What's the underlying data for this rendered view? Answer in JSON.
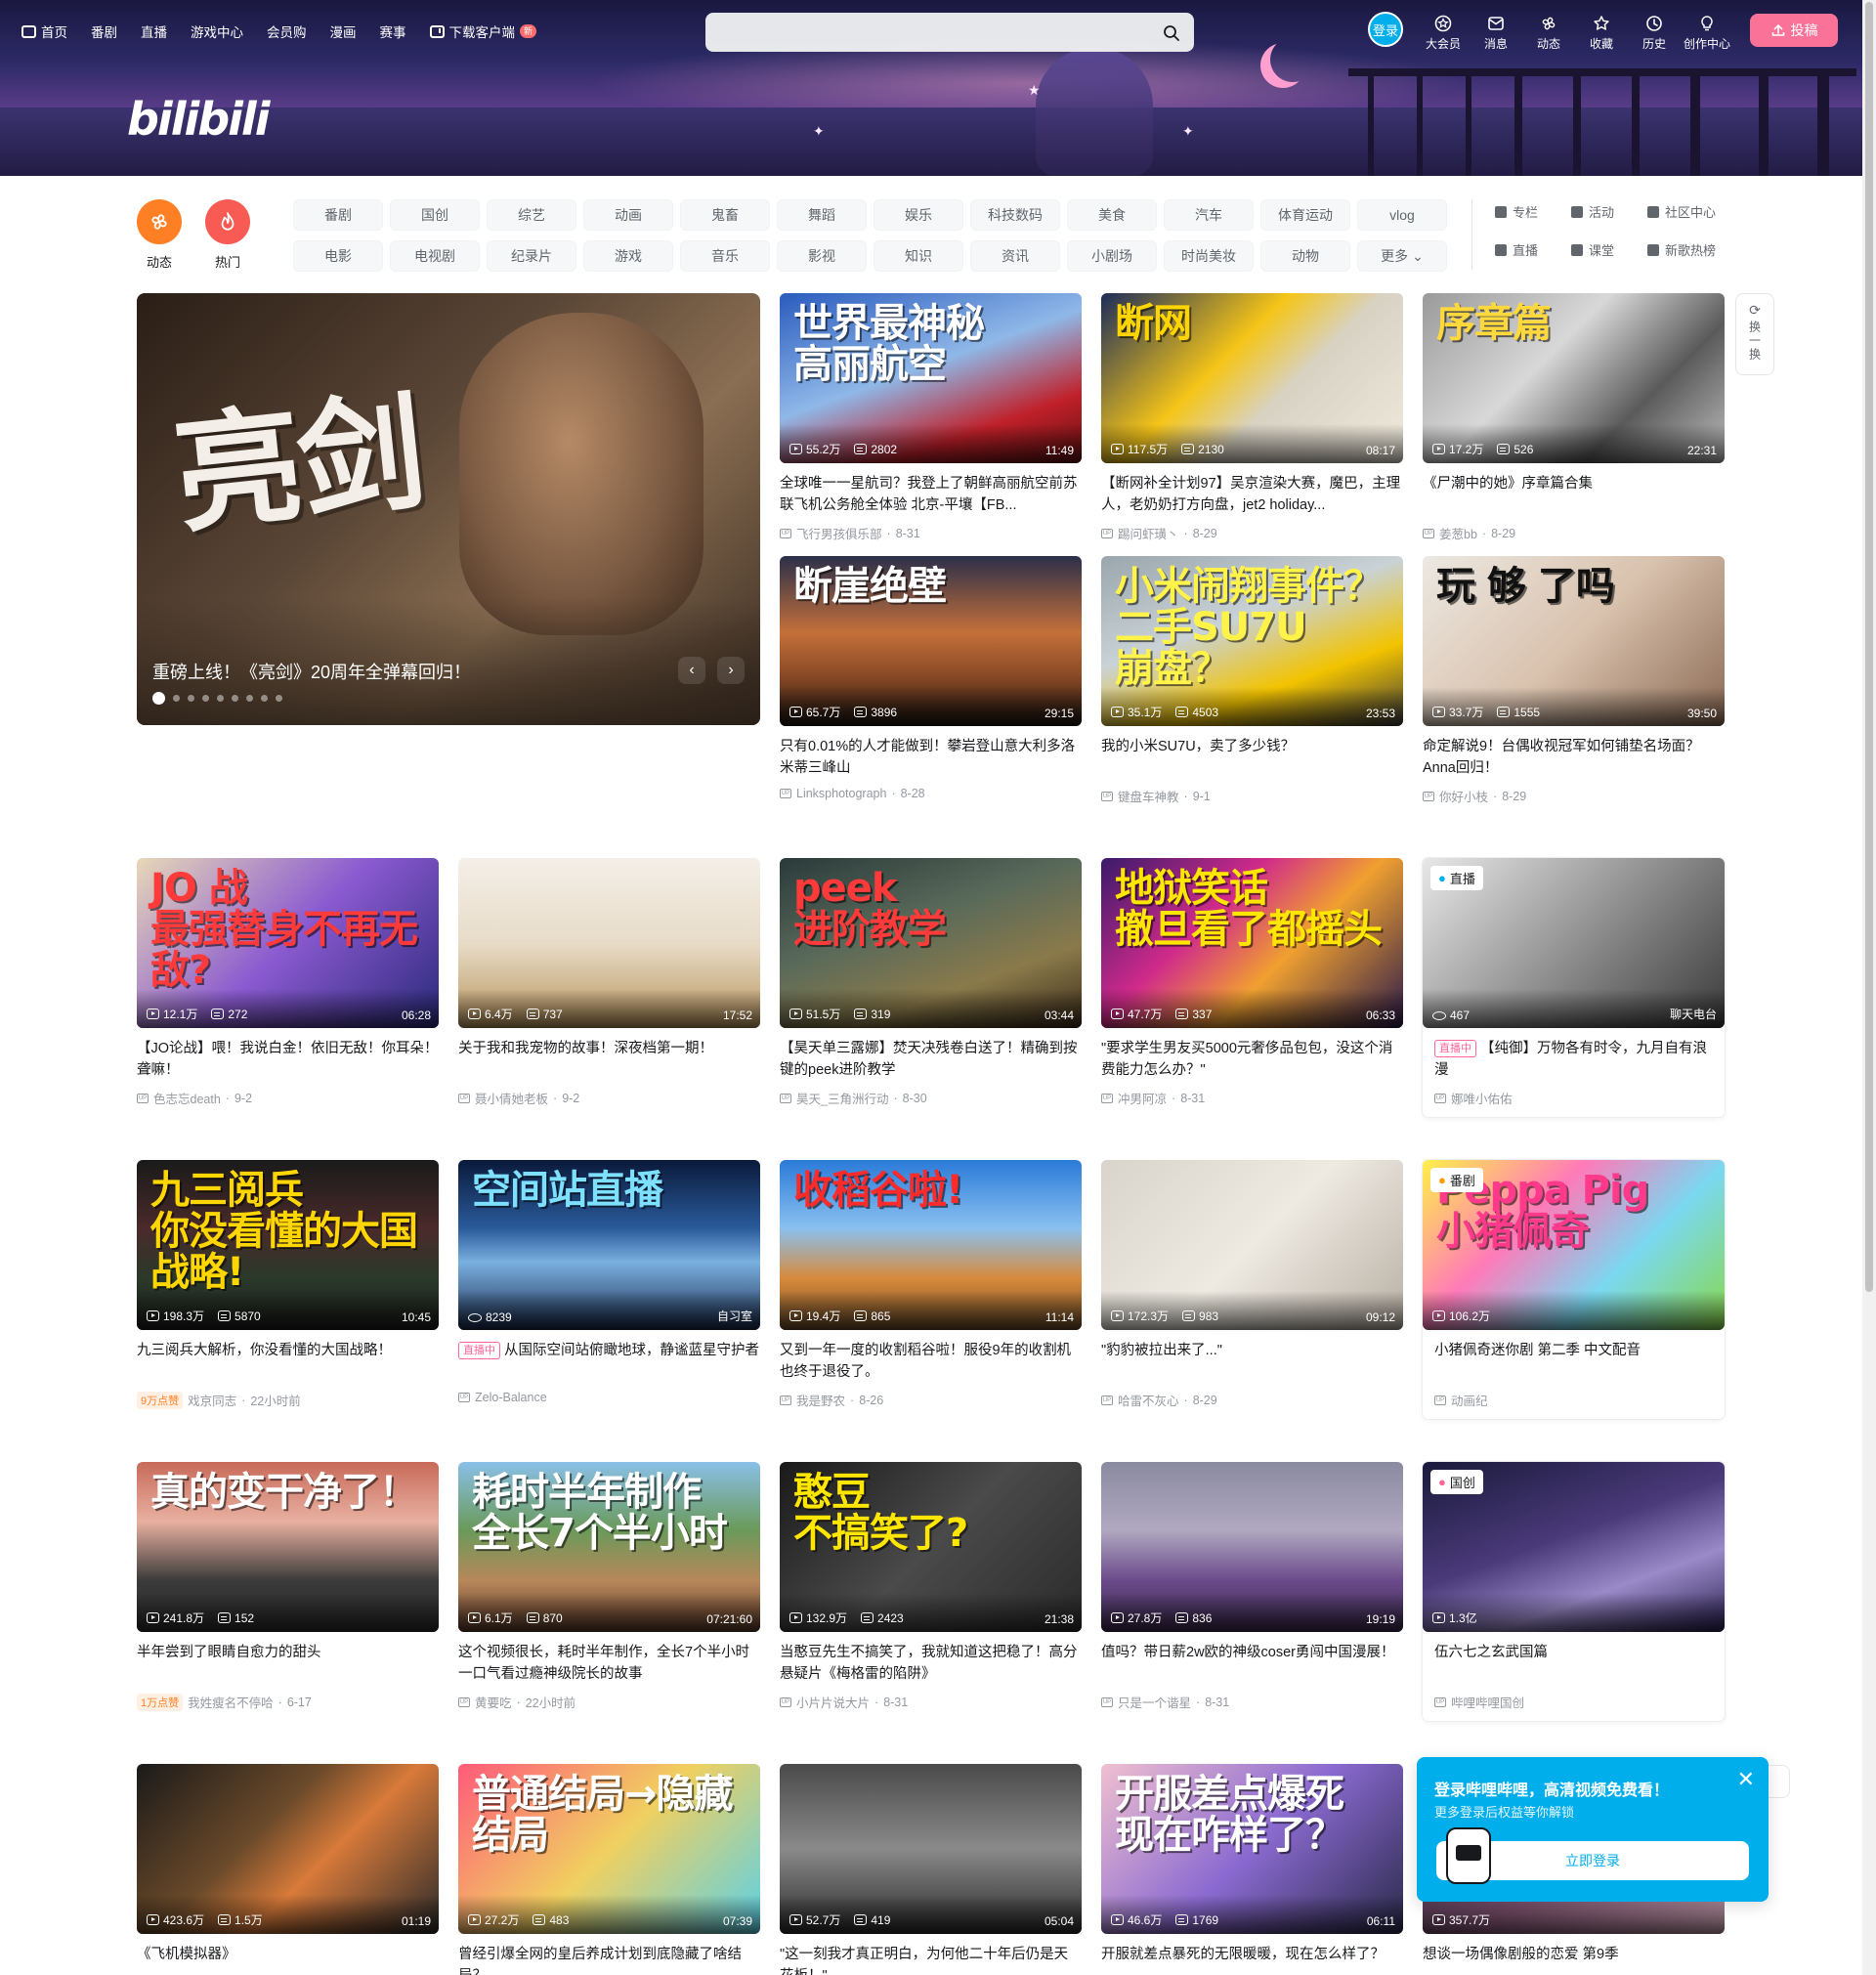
{
  "nav": {
    "left": [
      "首页",
      "番剧",
      "直播",
      "游戏中心",
      "会员购",
      "漫画",
      "赛事",
      "下载客户端"
    ],
    "new_badge": "新",
    "search_placeholder": "",
    "login_label": "登录",
    "right": [
      "大会员",
      "消息",
      "动态",
      "收藏",
      "历史",
      "创作中心"
    ],
    "right_icons": [
      "vip-icon",
      "message-icon",
      "dynamic-icon",
      "favorite-icon",
      "history-icon",
      "lightbulb-icon"
    ],
    "upload_label": "投稿"
  },
  "banner": {
    "logo": "bilibili"
  },
  "quick": [
    {
      "label": "动态",
      "color": "#ff7f24"
    },
    {
      "label": "热门",
      "color": "#f85a54"
    }
  ],
  "channels": [
    "番剧",
    "国创",
    "综艺",
    "动画",
    "鬼畜",
    "舞蹈",
    "娱乐",
    "科技数码",
    "美食",
    "汽车",
    "体育运动",
    "vlog",
    "电影",
    "电视剧",
    "纪录片",
    "游戏",
    "音乐",
    "影视",
    "知识",
    "资讯",
    "小剧场",
    "时尚美妆",
    "动物",
    "更多"
  ],
  "side_links": [
    "专栏",
    "活动",
    "社区中心",
    "直播",
    "课堂",
    "新歌热榜"
  ],
  "hero": {
    "art_text": "亮剑",
    "title": "重磅上线！《亮剑》20周年全弹幕回归！",
    "dots": 9,
    "active_dot": 0
  },
  "refresh_label": "换一换",
  "cards": [
    {
      "art": "世界最神秘\n高丽航空",
      "bg": "linear-gradient(160deg,#2a5bbd,#8fb8e8 45%,#c0202a 75%,#601010)",
      "art_color": "#fff",
      "views": "55.2万",
      "danmaku": "2802",
      "duration": "11:49",
      "title": "全球唯一一星航司？我登上了朝鲜高丽航空前苏联飞机公务舱全体验 北京-平壤【FB...",
      "up": "飞行男孩俱乐部",
      "date": "8-31"
    },
    {
      "art": "断网",
      "bg": "linear-gradient(135deg,#1c2c5a,#f5c518 40%,#d8d2c4 60%,#f0eadc)",
      "art_color": "#ffd500",
      "views": "117.5万",
      "danmaku": "2130",
      "duration": "08:17",
      "title": "【断网补全计划97】吴京渲染大赛，魔巴，主理人，老奶奶打方向盘，jet2 holiday...",
      "up": "踢问虾璜丶",
      "date": "8-29"
    },
    {
      "art": "序章篇",
      "bg": "linear-gradient(135deg,#9a9a9a,#d8d8d8 40%,#5a5a5a 70%,#bdbdbd)",
      "art_color": "#ffd93b",
      "views": "17.2万",
      "danmaku": "526",
      "duration": "22:31",
      "title": "《尸潮中的她》序章篇合集",
      "up": "姜葱bb",
      "date": "8-29"
    },
    {
      "art": "断崖绝壁",
      "bg": "linear-gradient(180deg,#2b2f4a,#c4703a 45%,#8a4a26 70%,#1c1410)",
      "art_color": "#fff",
      "views": "65.7万",
      "danmaku": "3896",
      "duration": "29:15",
      "title": "只有0.01%的人才能做到！攀岩登山意大利多洛米蒂三峰山",
      "up": "Linksphotograph",
      "date": "8-28"
    },
    {
      "art": "小米闹翔事件？\n二手SU7U\n崩盘？",
      "bg": "linear-gradient(160deg,#9aa6ad,#c9d2d6 40%,#f2c300 70%,#3a3a3a)",
      "art_color": "#fff34a",
      "views": "35.1万",
      "danmaku": "4503",
      "duration": "23:53",
      "title": "我的小米SU7U，卖了多少钱？",
      "up": "键盘车神教",
      "date": "9-1"
    },
    {
      "art": "玩 够 了吗",
      "bg": "linear-gradient(135deg,#ece8e2,#d9c2ae 50%,#8a6a54)",
      "art_color": "#111",
      "views": "33.7万",
      "danmaku": "1555",
      "duration": "39:50",
      "title": "命定解说9！台偶收视冠军如何铺垫名场面？Anna回归！",
      "up": "你好小枝",
      "date": "8-29"
    },
    {
      "art": "JO 战\n最强替身不再无敌?",
      "bg": "linear-gradient(135deg,#e8d8b8,#8a5ad0 50%,#2a2a7a)",
      "art_color": "#ff3a3a",
      "views": "12.1万",
      "danmaku": "272",
      "duration": "06:28",
      "title": "【JO论战】喂！我说白金！依旧无敌！你耳朵！聋嘛！",
      "up": "色志忘death",
      "date": "9-2"
    },
    {
      "art": "",
      "bg": "linear-gradient(180deg,#f4efe8,#e8dcc8 50%,#b8935c)",
      "art_color": "#fff",
      "views": "6.4万",
      "danmaku": "737",
      "duration": "17:52",
      "title": "关于我和我宠物的故事！深夜档第一期！",
      "up": "聂小倩她老板",
      "date": "9-2"
    },
    {
      "art": "peek\n进阶教学",
      "bg": "linear-gradient(160deg,#2a3a3a,#5a6a5a 40%,#8a7a4a 70%,#3a2a1a)",
      "art_color": "#ff3a3a",
      "views": "51.5万",
      "danmaku": "319",
      "duration": "03:44",
      "title": "【昊天单三露娜】焚天决残卷白送了！精确到按键的peek进阶教学",
      "up": "昊天_三角洲行动",
      "date": "8-30"
    },
    {
      "art": "地狱笑话\n撤旦看了都摇头",
      "bg": "linear-gradient(135deg,#3a1a6a,#d02a8a 35%,#f0a030 60%,#2a1a4a)",
      "art_color": "#ffe600",
      "views": "47.7万",
      "danmaku": "337",
      "duration": "06:33",
      "title": "\"要求学生男友买5000元奢侈品包包，没这个消费能力怎么办？\"",
      "up": "冲男阿凉",
      "date": "8-31"
    },
    {
      "tag": "直播",
      "art": "",
      "bg": "linear-gradient(135deg,#e8e8e8,#9a9a9a 45%,#3a3a3a)",
      "art_color": "#fff",
      "viewers": "467",
      "room": "聊天电台",
      "live": "直播中",
      "title": "【纯御】万物各有时令，九月自有浪漫",
      "up": "娜唯小佑佑",
      "date": ""
    },
    {
      "art": "九三阅兵\n你没看懂的大国战略!",
      "bg": "linear-gradient(180deg,#1a1a1a,#4a2a2a 40%,#2a3a2a 70%,#1a1a1a)",
      "art_color": "#ffd600",
      "views": "198.3万",
      "danmaku": "5870",
      "duration": "10:45",
      "title": "九三阅兵大解析，你没看懂的大国战略！",
      "up": "戏京同志",
      "date": "22小时前",
      "likes": "9万点赞"
    },
    {
      "art": "空间站直播",
      "bg": "linear-gradient(180deg,#0a1a3a,#2a5a9a 40%,#7ab0e0 60%,#1a2a4a)",
      "art_color": "#7ee0ff",
      "viewers": "8239",
      "room": "自习室",
      "live": "直播中",
      "title": "从国际空间站俯瞰地球，静谧蓝星守护者",
      "up": "Zelo-Balance",
      "date": ""
    },
    {
      "art": "收稻谷啦!",
      "bg": "linear-gradient(180deg,#2a7ad8,#8ac0f0 40%,#d88a3a 70%,#6a4a2a)",
      "art_color": "#ff2a2a",
      "views": "19.4万",
      "danmaku": "865",
      "duration": "11:14",
      "title": "又到一年一度的收割稻谷啦！服役9年的收割机也终于退役了。",
      "up": "我是野农",
      "date": "8-26"
    },
    {
      "art": "",
      "bg": "linear-gradient(135deg,#d8d4cc,#eeeae2 50%,#b8b0a4)",
      "art_color": "#fff",
      "views": "172.3万",
      "danmaku": "983",
      "duration": "09:12",
      "title": "\"豹豹被拉出来了...\"",
      "up": "哈雷不灰心",
      "date": "8-29"
    },
    {
      "tag": "番剧",
      "art": "Peppa Pig\n小猪佩奇",
      "bg": "linear-gradient(135deg,#fff04a,#ff7ab8 35%,#7ad8f0 65%,#8ad84a)",
      "art_color": "#ff3a8a",
      "views": "106.2万",
      "title": "小猪佩奇迷你剧 第二季 中文配音",
      "up": "动画纪",
      "date": ""
    },
    {
      "art": "真的变干净了！",
      "bg": "linear-gradient(180deg,#c86a5a,#e8b0a0 35%,#3a3a3a 70%,#2a2a2a)",
      "art_color": "#fff",
      "views": "241.8万",
      "danmaku": "152",
      "duration": "",
      "title": "半年尝到了眼睛自愈力的甜头",
      "up": "我姓瘦名不停哈",
      "date": "6-17",
      "likes": "1万点赞"
    },
    {
      "art": "耗时半年制作\n全长7个半小时",
      "bg": "linear-gradient(180deg,#8ac0e8,#6a9a5a 40%,#b8875a 70%,#5a3a2a)",
      "art_color": "#fff",
      "views": "6.1万",
      "danmaku": "870",
      "duration": "07:21:60",
      "title": "这个视频很长，耗时半年制作，全长7个半小时一口气看过瘾神级院长的故事",
      "up": "黄要吃",
      "date": "22小时前"
    },
    {
      "art": "憨豆\n不搞笑了?",
      "bg": "linear-gradient(135deg,#1a1a1a,#4a4a4a 50%,#2a2a2a)",
      "art_color": "#ffe600",
      "views": "132.9万",
      "danmaku": "2423",
      "duration": "21:38",
      "title": "当憨豆先生不搞笑了，我就知道这把稳了！高分悬疑片《梅格雷的陷阱》",
      "up": "小片片说大片",
      "date": "8-31"
    },
    {
      "art": "",
      "bg": "linear-gradient(180deg,#8a8aa0,#b0a8c0 40%,#6a4a8a 70%,#3a2a4a)",
      "art_color": "#fff",
      "views": "27.8万",
      "danmaku": "836",
      "duration": "19:19",
      "title": "值吗？带日薪2w欧的神级coser勇闯中国漫展！",
      "up": "只是一个谐星",
      "date": "8-31"
    },
    {
      "tag": "国创",
      "art": "",
      "bg": "linear-gradient(160deg,#1a1a3a,#4a3a7a 45%,#9a8ac8 70%,#2a2050)",
      "art_color": "#fff",
      "views": "1.3亿",
      "title": "伍六七之玄武国篇",
      "up": "哔哩哔哩国创",
      "date": ""
    },
    {
      "art": "",
      "bg": "linear-gradient(135deg,#1a1a1a,#6a4a2a 40%,#d87a3a 60%,#2a2a2a)",
      "art_color": "#fff",
      "views": "423.6万",
      "danmaku": "1.5万",
      "duration": "01:19",
      "title": "《飞机模拟器》",
      "up": "",
      "date": ""
    },
    {
      "art": "普通结局→隐藏结局",
      "bg": "linear-gradient(135deg,#ff5a7a,#f0d060 50%,#5ad0e8)",
      "art_color": "#fff",
      "views": "27.2万",
      "danmaku": "483",
      "duration": "07:39",
      "title": "曾经引爆全网的皇后养成计划到底隐藏了啥结局？",
      "up": "",
      "date": ""
    },
    {
      "art": "",
      "bg": "linear-gradient(180deg,#4a4a4a,#8a8a8a 50%,#2a2a2a)",
      "art_color": "#fff",
      "views": "52.7万",
      "danmaku": "419",
      "duration": "05:04",
      "title": "\"这一刻我才真正明白，为何他二十年后仍是天花板！\"",
      "up": "",
      "date": ""
    },
    {
      "art": "开服差点爆死\n现在咋样了？",
      "bg": "linear-gradient(135deg,#f0c0d0,#8a6ad0 50%,#2a2a4a)",
      "art_color": "#fff",
      "views": "46.6万",
      "danmaku": "1769",
      "duration": "06:11",
      "title": "开服就差点暴死的无限暖暖，现在怎么样了？",
      "up": "",
      "date": ""
    },
    {
      "art": "",
      "bg": "linear-gradient(135deg,#3a2a4a,#8a5a7a 50%,#c8a0b0)",
      "art_color": "#fff",
      "views": "357.7万",
      "title": "想谈一场偶像剧般的恋爱 第9季",
      "up": "",
      "date": ""
    }
  ],
  "popup": {
    "title": "登录哔哩哔哩，高清视频免费看！",
    "subtitle": "更多登录后权益等你解锁",
    "button": "立即登录",
    "close": "✕"
  }
}
